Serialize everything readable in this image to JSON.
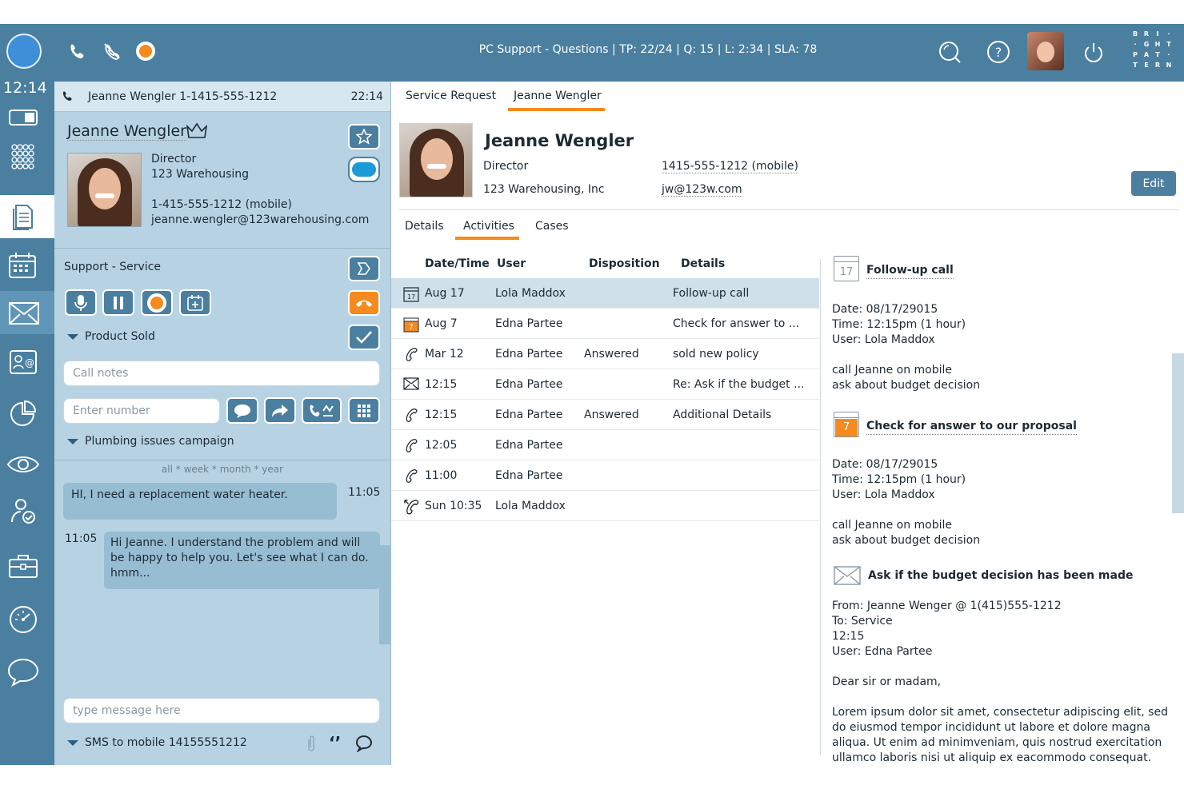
{
  "topbar": {
    "queue_info": "PC Support - Questions | TP: 22/24 | Q: 15 | L: 2:34 | SLA: 78",
    "brand_letters": [
      "B",
      "R",
      "I",
      "·",
      "·",
      "G",
      "H",
      "T",
      "P",
      "A",
      "T",
      "·",
      "T",
      "E",
      "R",
      "N"
    ]
  },
  "sidebar": {
    "clock": "12:14"
  },
  "call": {
    "header_label": "Jeanne Wengler 1-1415-555-1212",
    "header_time": "22:14",
    "contact_name": "Jeanne Wengler",
    "title": "Director",
    "company": "123 Warehousing",
    "phone": "1-415-555-1212 (mobile)",
    "email": "jeanne.wengler@123warehousing.com",
    "service": "Support - Service",
    "product_sold": "Product Sold",
    "call_notes_placeholder": "Call notes",
    "enter_number_placeholder": "Enter number",
    "campaign": "Plumbing issues campaign",
    "filter": "all * week * month * year",
    "messages": [
      {
        "text": "HI, I need a replacement water heater.",
        "time": "11:05"
      },
      {
        "text": "Hi Jeanne. I understand the problem and will be happy to help you. Let's see what I can do. hmm...",
        "time": "11:05"
      }
    ],
    "message_placeholder": "type message here",
    "sms_to": "SMS to mobile 14155551212"
  },
  "main": {
    "tabs": [
      "Service Request",
      "Jeanne Wengler"
    ],
    "contact": {
      "name": "Jeanne Wengler",
      "title": "Director",
      "company": "123 Warehousing, Inc",
      "phone": "1415-555-1212 (mobile)",
      "email": "jw@123w.com",
      "edit": "Edit"
    },
    "subtabs": [
      "Details",
      "Activities",
      "Cases"
    ],
    "columns": [
      "Date/Time",
      "User",
      "Disposition",
      "Details"
    ],
    "rows": [
      {
        "icon": "calendar-icon",
        "date": "Aug 17",
        "user": "Lola Maddox",
        "disposition": "",
        "details": "Follow-up call"
      },
      {
        "icon": "calendar-orange-icon",
        "date": "Aug 7",
        "user": "Edna Partee",
        "disposition": "",
        "details": "Check for answer to ..."
      },
      {
        "icon": "phone-icon",
        "date": "Mar 12",
        "user": "Edna Partee",
        "disposition": "Answered",
        "details": "sold new policy"
      },
      {
        "icon": "envelope-icon",
        "date": "12:15",
        "user": "Edna Partee",
        "disposition": "",
        "details": "Re: Ask if the budget ..."
      },
      {
        "icon": "phone-icon",
        "date": "12:15",
        "user": "Edna Partee",
        "disposition": "Answered",
        "details": "Additional Details"
      },
      {
        "icon": "phone-icon",
        "date": "12:05",
        "user": "Edna Partee",
        "disposition": "",
        "details": ""
      },
      {
        "icon": "phone-icon",
        "date": "11:00",
        "user": "Edna Partee",
        "disposition": "",
        "details": ""
      },
      {
        "icon": "missed-call-icon",
        "date": "Sun 10:35",
        "user": "Lola Maddox",
        "disposition": "",
        "details": ""
      }
    ],
    "detail": {
      "item1_day": "17",
      "item1_title": "Follow-up call",
      "item1_lines": [
        "Date: 08/17/29015",
        "Time: 12:15pm (1 hour)",
        "User: Lola Maddox"
      ],
      "item1_note": [
        "call Jeanne on mobile",
        "ask about budget decision"
      ],
      "item2_day": "7",
      "item2_title": "Check for answer to our proposal",
      "item2_lines": [
        "Date: 08/17/29015",
        "Time: 12:15pm (1 hour)",
        "User: Lola Maddox"
      ],
      "item2_note": [
        "call Jeanne on mobile",
        "ask about budget decision"
      ],
      "item3_title": "Ask if the budget decision has been made",
      "item3_lines": [
        "From: Jeanne Wenger @ 1(415)555-1212",
        "To: Service",
        "12:15",
        "User: Edna Partee"
      ],
      "item3_greeting": "Dear sir or madam,",
      "item3_body": "Lorem ipsum dolor sit amet, consectetur adipiscing elit, sed do eiusmod tempor incididunt ut labore et dolore magna aliqua. Ut enim ad minimveniam, quis nostrud exercitation ullamco laboris nisi ut aliquip ex eacommodo consequat. Duis"
    }
  },
  "colors": {
    "primary": "#4a7fa0",
    "panel": "#b7d3e3",
    "accent": "#f58a1f"
  }
}
